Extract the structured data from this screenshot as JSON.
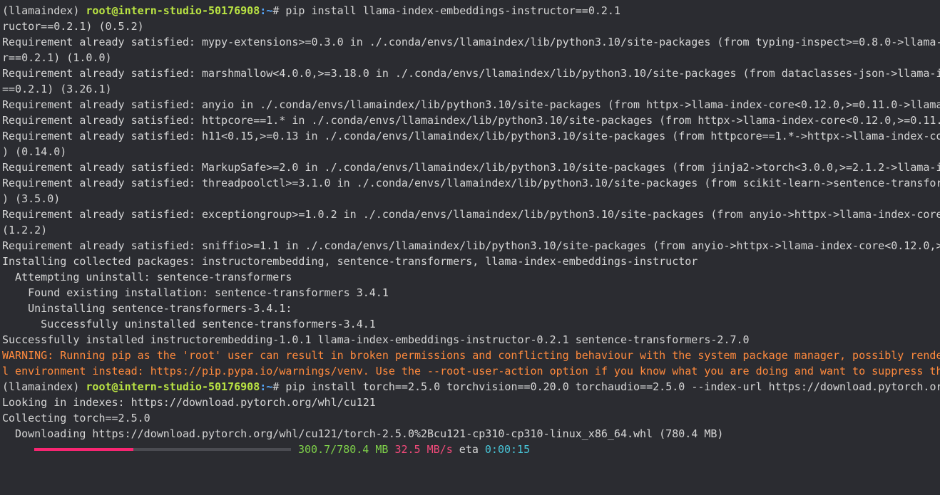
{
  "prompt": {
    "env": "(llamaindex) ",
    "user": "root@intern-studio-50176908",
    "path": ":~",
    "symbol": "# "
  },
  "lines": [
    {
      "type": "prompt",
      "command": "pip install llama-index-embeddings-instructor==0.2.1"
    },
    {
      "type": "text",
      "text": "ructor==0.2.1) (0.5.2)"
    },
    {
      "type": "text",
      "text": "Requirement already satisfied: mypy-extensions>=0.3.0 in ./.conda/envs/llamaindex/lib/python3.10/site-packages (from typing-inspect>=0.8.0->llama-"
    },
    {
      "type": "text",
      "text": "r==0.2.1) (1.0.0)"
    },
    {
      "type": "text",
      "text": "Requirement already satisfied: marshmallow<4.0.0,>=3.18.0 in ./.conda/envs/llamaindex/lib/python3.10/site-packages (from dataclasses-json->llama-i"
    },
    {
      "type": "text",
      "text": "==0.2.1) (3.26.1)"
    },
    {
      "type": "text",
      "text": "Requirement already satisfied: anyio in ./.conda/envs/llamaindex/lib/python3.10/site-packages (from httpx->llama-index-core<0.12.0,>=0.11.0->llama"
    },
    {
      "type": "text",
      "text": "Requirement already satisfied: httpcore==1.* in ./.conda/envs/llamaindex/lib/python3.10/site-packages (from httpx->llama-index-core<0.12.0,>=0.11."
    },
    {
      "type": "text",
      "text": "Requirement already satisfied: h11<0.15,>=0.13 in ./.conda/envs/llamaindex/lib/python3.10/site-packages (from httpcore==1.*->httpx->llama-index-co"
    },
    {
      "type": "text",
      "text": ") (0.14.0)"
    },
    {
      "type": "text",
      "text": "Requirement already satisfied: MarkupSafe>=2.0 in ./.conda/envs/llamaindex/lib/python3.10/site-packages (from jinja2->torch<3.0.0,>=2.1.2->llama-i"
    },
    {
      "type": "text",
      "text": "Requirement already satisfied: threadpoolctl>=3.1.0 in ./.conda/envs/llamaindex/lib/python3.10/site-packages (from scikit-learn->sentence-transfor"
    },
    {
      "type": "text",
      "text": ") (3.5.0)"
    },
    {
      "type": "text",
      "text": "Requirement already satisfied: exceptiongroup>=1.0.2 in ./.conda/envs/llamaindex/lib/python3.10/site-packages (from anyio->httpx->llama-index-core"
    },
    {
      "type": "text",
      "text": "(1.2.2)"
    },
    {
      "type": "text",
      "text": "Requirement already satisfied: sniffio>=1.1 in ./.conda/envs/llamaindex/lib/python3.10/site-packages (from anyio->httpx->llama-index-core<0.12.0,>"
    },
    {
      "type": "text",
      "text": "Installing collected packages: instructorembedding, sentence-transformers, llama-index-embeddings-instructor"
    },
    {
      "type": "text",
      "text": "  Attempting uninstall: sentence-transformers"
    },
    {
      "type": "text",
      "text": "    Found existing installation: sentence-transformers 3.4.1"
    },
    {
      "type": "text",
      "text": "    Uninstalling sentence-transformers-3.4.1:"
    },
    {
      "type": "text",
      "text": "      Successfully uninstalled sentence-transformers-3.4.1"
    },
    {
      "type": "text",
      "text": "Successfully installed instructorembedding-1.0.1 llama-index-embeddings-instructor-0.2.1 sentence-transformers-2.7.0"
    },
    {
      "type": "warn",
      "text": "WARNING: Running pip as the 'root' user can result in broken permissions and conflicting behaviour with the system package manager, possibly rende"
    },
    {
      "type": "warn",
      "text": "l environment instead: https://pip.pypa.io/warnings/venv. Use the --root-user-action option if you know what you are doing and want to suppress th"
    },
    {
      "type": "prompt",
      "command": "pip install torch==2.5.0 torchvision==0.20.0 torchaudio==2.5.0 --index-url https://download.pytorch.or"
    },
    {
      "type": "text",
      "text": "Looking in indexes: https://download.pytorch.org/whl/cu121"
    },
    {
      "type": "text",
      "text": "Collecting torch==2.5.0"
    },
    {
      "type": "text",
      "text": "  Downloading https://download.pytorch.org/whl/cu121/torch-2.5.0%2Bcu121-cp310-cp310-linux_x86_64.whl (780.4 MB)"
    }
  ],
  "progress": {
    "fraction": 0.385,
    "size": "300.7/780.4 MB",
    "speed": "32.5 MB/s",
    "eta_label": "eta",
    "eta": "0:00:15"
  },
  "colors": {
    "background": "#2b2c31",
    "text": "#d6d6d6",
    "user": "#b9e343",
    "path": "#56a9ff",
    "warning": "#ff8a3d",
    "bar_fill": "#f92672"
  }
}
